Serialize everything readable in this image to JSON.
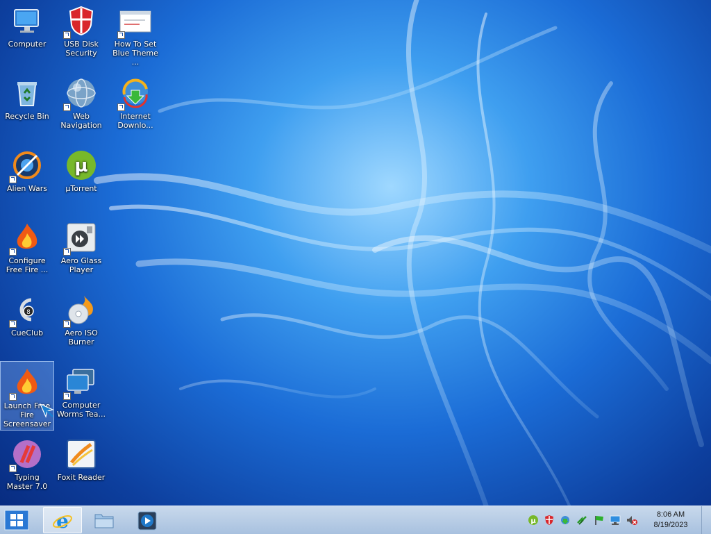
{
  "desktop": {
    "icons": [
      {
        "label": "Computer",
        "icon": "computer-monitor-icon"
      },
      {
        "label": "USB Disk Security",
        "icon": "shield-icon"
      },
      {
        "label": "How To Set Blue Theme ...",
        "icon": "document-window-icon"
      },
      {
        "label": "Recycle Bin",
        "icon": "recycle-bin-icon"
      },
      {
        "label": "Web Navigation",
        "icon": "globe-icon"
      },
      {
        "label": "Internet Downlo...",
        "icon": "download-manager-icon"
      },
      {
        "label": "Alien Wars",
        "icon": "game-ring-icon"
      },
      {
        "label": "µTorrent",
        "icon": "utorrent-icon"
      },
      {
        "label": "Configure Free Fire ...",
        "icon": "flame-icon"
      },
      {
        "label": "Aero Glass Player",
        "icon": "media-player-gadget-icon"
      },
      {
        "label": "CueClub",
        "icon": "cueclub-icon"
      },
      {
        "label": "Aero ISO Burner",
        "icon": "disc-burner-icon"
      },
      {
        "label": "Launch Free Fire Screensaver",
        "icon": "flame-icon"
      },
      {
        "label": "Computer Worms Tea...",
        "icon": "computer-monitors-icon"
      },
      {
        "label": "Typing Master 7.0",
        "icon": "typing-master-icon"
      },
      {
        "label": "Foxit Reader",
        "icon": "foxit-reader-icon"
      }
    ]
  },
  "taskbar": {
    "start": {
      "icon": "windows-logo-icon"
    },
    "pinned": [
      {
        "name": "Internet Explorer",
        "icon": "internet-explorer-icon"
      },
      {
        "name": "File Explorer",
        "icon": "folder-icon"
      },
      {
        "name": "Media Player",
        "icon": "media-player-icon"
      }
    ],
    "tray": [
      "utorrent-tray-icon",
      "shield-tray-icon",
      "download-tray-icon",
      "arrows-tray-icon",
      "flag-tray-icon",
      "network-tray-icon",
      "volume-muted-tray-icon"
    ],
    "clock": {
      "time": "8:06 AM",
      "date": "8/19/2023"
    }
  }
}
